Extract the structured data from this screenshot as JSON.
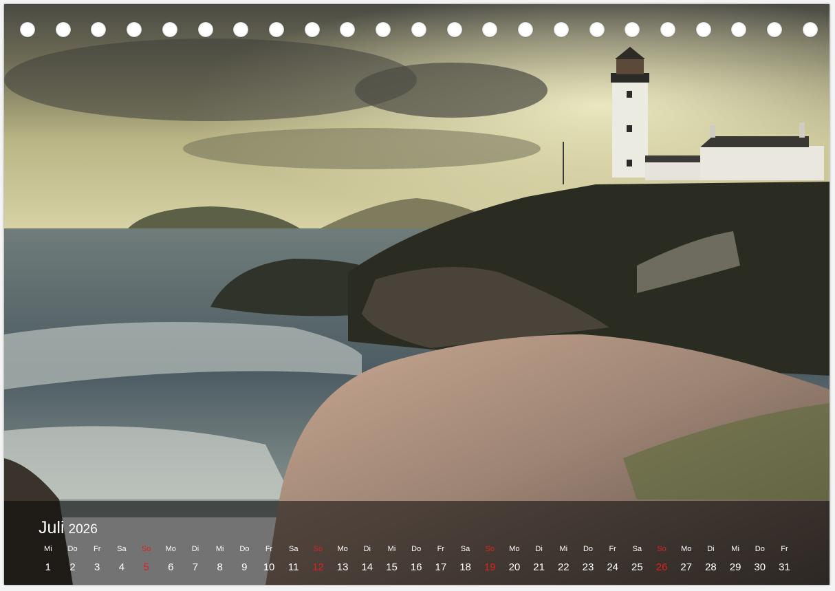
{
  "calendar": {
    "month": "Juli",
    "year": "2026",
    "sunday_color": "#e0201e",
    "days": [
      {
        "weekday": "Mi",
        "date": "1"
      },
      {
        "weekday": "Do",
        "date": "2"
      },
      {
        "weekday": "Fr",
        "date": "3"
      },
      {
        "weekday": "Sa",
        "date": "4"
      },
      {
        "weekday": "So",
        "date": "5",
        "sunday": true
      },
      {
        "weekday": "Mo",
        "date": "6"
      },
      {
        "weekday": "Di",
        "date": "7"
      },
      {
        "weekday": "Mi",
        "date": "8"
      },
      {
        "weekday": "Do",
        "date": "9"
      },
      {
        "weekday": "Fr",
        "date": "10"
      },
      {
        "weekday": "Sa",
        "date": "11"
      },
      {
        "weekday": "So",
        "date": "12",
        "sunday": true
      },
      {
        "weekday": "Mo",
        "date": "13"
      },
      {
        "weekday": "Di",
        "date": "14"
      },
      {
        "weekday": "Mi",
        "date": "15"
      },
      {
        "weekday": "Do",
        "date": "16"
      },
      {
        "weekday": "Fr",
        "date": "17"
      },
      {
        "weekday": "Sa",
        "date": "18"
      },
      {
        "weekday": "So",
        "date": "19",
        "sunday": true
      },
      {
        "weekday": "Mo",
        "date": "20"
      },
      {
        "weekday": "Di",
        "date": "21"
      },
      {
        "weekday": "Mi",
        "date": "22"
      },
      {
        "weekday": "Do",
        "date": "23"
      },
      {
        "weekday": "Fr",
        "date": "24"
      },
      {
        "weekday": "Sa",
        "date": "25"
      },
      {
        "weekday": "So",
        "date": "26",
        "sunday": true
      },
      {
        "weekday": "Mo",
        "date": "27"
      },
      {
        "weekday": "Di",
        "date": "28"
      },
      {
        "weekday": "Mi",
        "date": "29"
      },
      {
        "weekday": "Do",
        "date": "30"
      },
      {
        "weekday": "Fr",
        "date": "31"
      }
    ]
  },
  "binding": {
    "hole_count": 23
  },
  "photo": {
    "subject": "lighthouse-on-rocky-coast",
    "sky_color": "#b9b585",
    "sea_color": "#5b6a6f",
    "rock_color": "#a88f7c"
  }
}
